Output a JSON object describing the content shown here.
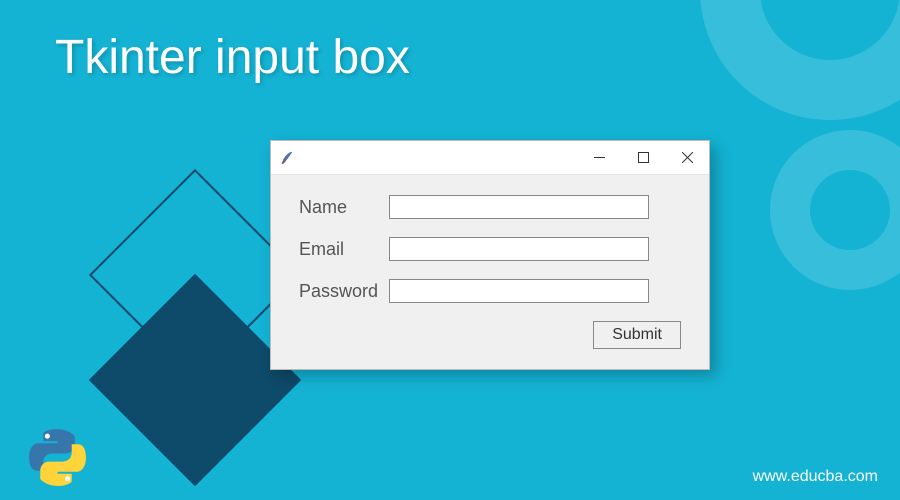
{
  "page": {
    "title": "Tkinter input box",
    "footer_url": "www.educba.com"
  },
  "window": {
    "fields": {
      "name": {
        "label": "Name",
        "value": ""
      },
      "email": {
        "label": "Email",
        "value": ""
      },
      "password": {
        "label": "Password",
        "value": ""
      }
    },
    "submit_label": "Submit"
  }
}
